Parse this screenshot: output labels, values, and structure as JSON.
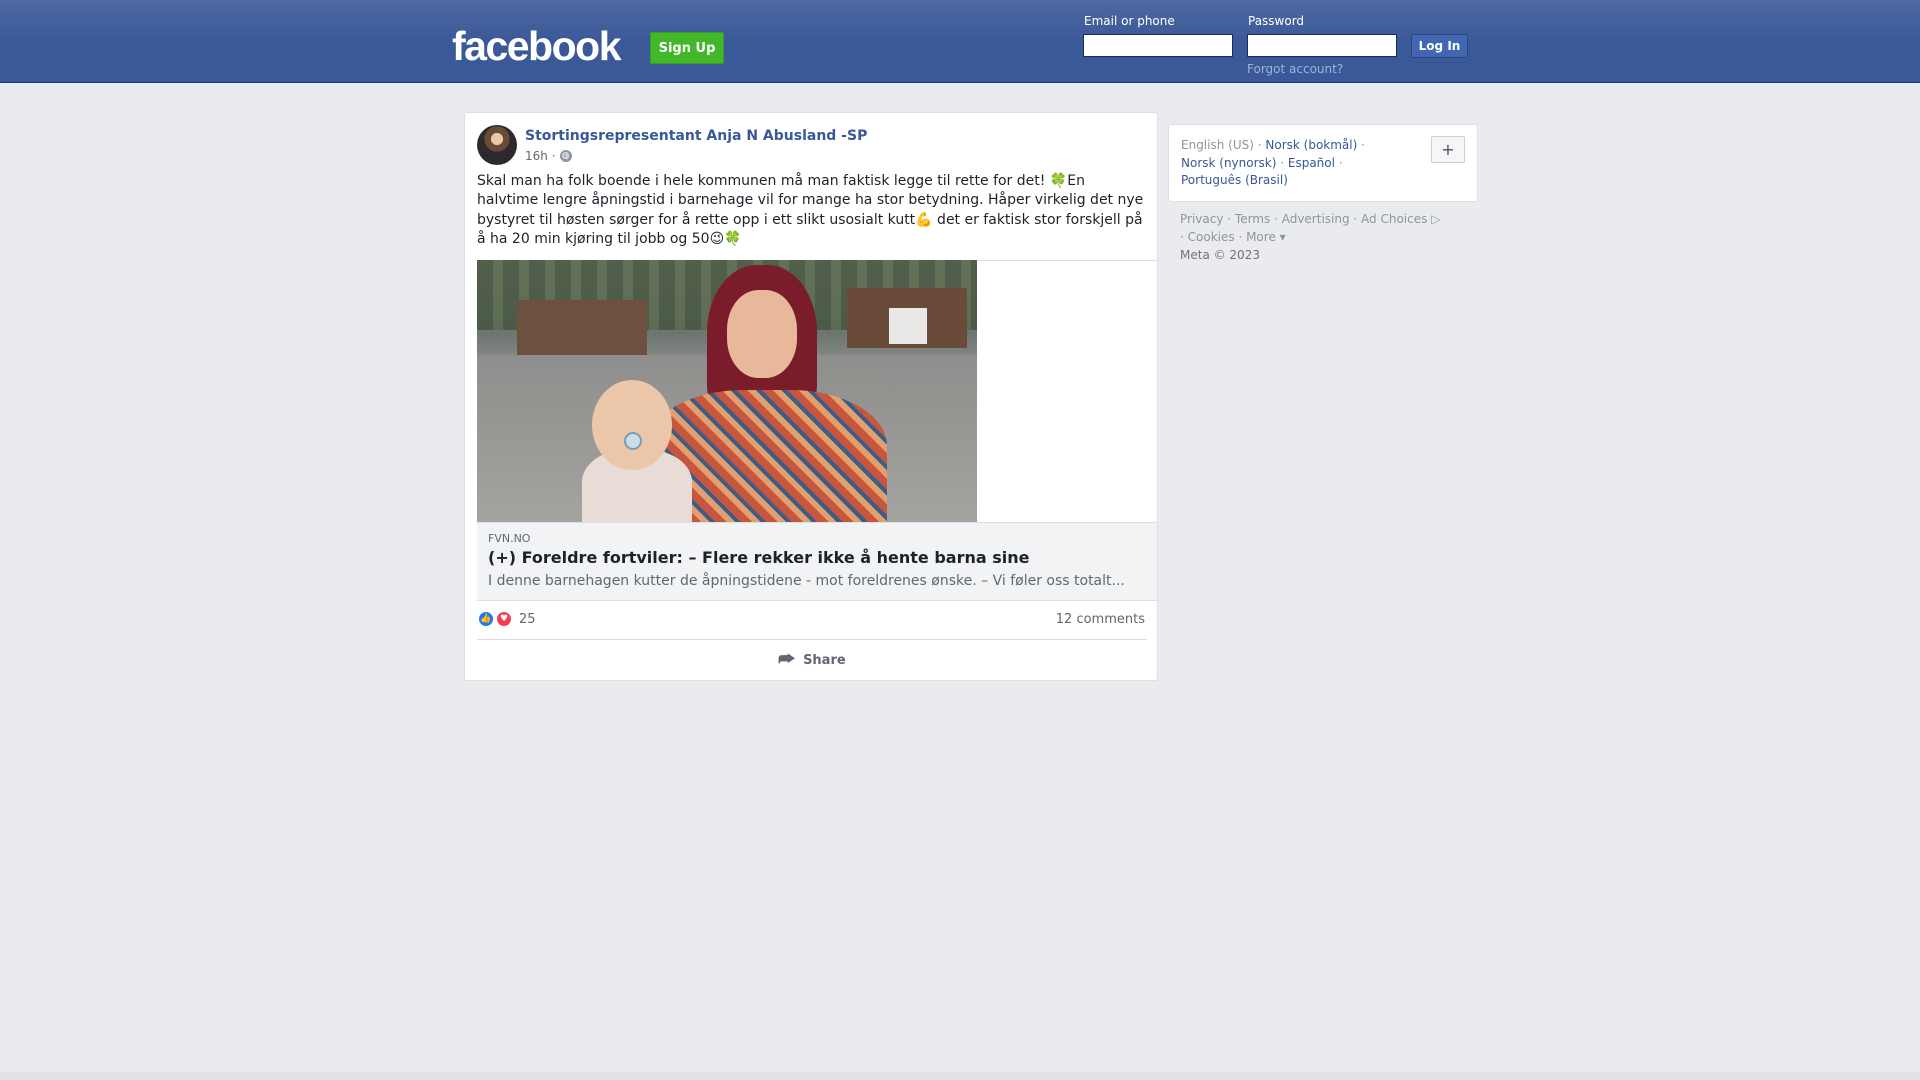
{
  "header": {
    "logo_text": "facebook",
    "signup_label": "Sign Up",
    "email_label": "Email or phone",
    "password_label": "Password",
    "email_value": "",
    "password_value": "",
    "login_label": "Log In",
    "forgot_label": "Forgot account?"
  },
  "post": {
    "author": "Stortingsrepresentant Anja N Abusland -SP",
    "time": "16h",
    "privacy_icon": "globe-icon",
    "text": "Skal man ha folk boende i hele kommunen må man faktisk legge til rette for det! 🍀En halvtime lengre åpningstid i barnehage vil for mange ha stor betydning. Håper virkelig det nye bystyret til høsten sørger for å rette opp i ett slikt usosialt kutt💪 det er faktisk stor forskjell på å ha 20 min kjøring til jobb og 50😉🍀",
    "link": {
      "domain": "FVN.NO",
      "headline": "(+) Foreldre fortviler: – Flere rekker ikke å hente barna sine",
      "description": "I denne barnehagen kutter de åpningstidene - mot foreldrenes ønske. – Vi føler oss totalt..."
    },
    "reaction_count": "25",
    "comments_label": "12 comments",
    "share_label": "Share"
  },
  "sidebar": {
    "current_language": "English (US)",
    "languages": [
      "Norsk (bokmål)",
      "Norsk (nynorsk)",
      "Español",
      "Português (Brasil)"
    ],
    "add_language_label": "+",
    "footer_links": [
      "Privacy",
      "Terms",
      "Advertising",
      "Ad Choices",
      "Cookies",
      "More"
    ],
    "copyright": "Meta © 2023"
  },
  "colors": {
    "brand_blue": "#3b5998",
    "signup_green": "#42b72a",
    "link_blue": "#385898",
    "background": "#e9ebee"
  }
}
